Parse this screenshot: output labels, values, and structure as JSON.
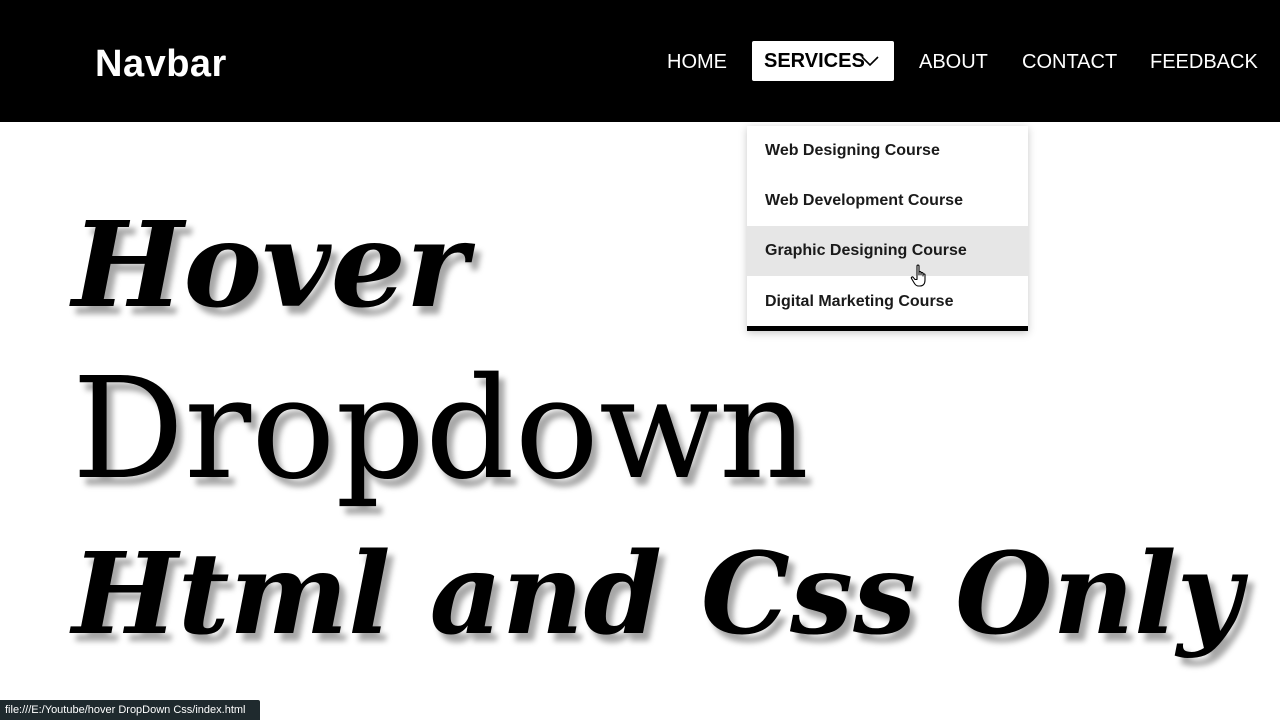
{
  "navbar": {
    "brand": "Navbar",
    "links": {
      "home": "HOME",
      "services": "SERVICES",
      "about": "ABOUT",
      "contact": "CONTACT",
      "feedback": "FEEDBACK"
    },
    "active_link": "services",
    "colors": {
      "background": "#000000",
      "text": "#ffffff",
      "active_bg": "#ffffff",
      "active_text": "#000000"
    }
  },
  "dropdown": {
    "items": [
      {
        "label": "Web Designing Course"
      },
      {
        "label": "Web Development Course"
      },
      {
        "label": "Graphic Designing Course"
      },
      {
        "label": "Digital Marketing Course"
      }
    ],
    "hovered_index": 2,
    "colors": {
      "hover_bg": "#e6e6e6",
      "bottom_border": "#000000"
    }
  },
  "headline": {
    "line1": "Hover",
    "line2": "Dropdown",
    "line3": "Html and Css Only"
  },
  "statusbar": {
    "url": "file:///E:/Youtube/hover DropDown Css/index.html"
  },
  "icons": {
    "services_chevron": "chevron-down-icon",
    "cursor": "hand-pointer-icon"
  }
}
